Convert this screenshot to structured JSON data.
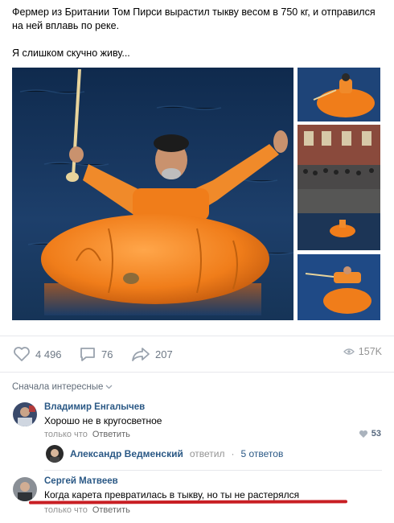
{
  "post": {
    "line1": "Фермер из Британии Том Пирси вырастил тыкву весом в 750 кг, и отправился на ней вплавь по реке.",
    "line2": "Я слишком скучно живу..."
  },
  "actions": {
    "likes": "4 496",
    "comments": "76",
    "shares": "207",
    "views": "157K"
  },
  "sort_label": "Сначала интересные",
  "comments": [
    {
      "author": "Владимир Енгалычев",
      "text": "Хорошо не в кругосветное",
      "time": "только что",
      "reply": "Ответить",
      "likes": "53"
    },
    {
      "author": "Сергей Матвеев",
      "text": "Когда карета превратилась в тыкву, но ты не растерялся",
      "time": "только что",
      "reply": "Ответить"
    }
  ],
  "thread": {
    "author": "Александр Ведменский",
    "replied": "ответил",
    "sep": "·",
    "count": "5 ответов"
  },
  "colors": {
    "link": "#2a5885",
    "water": "#1d3f6b",
    "pumpkin": "#f07d1a",
    "underline": "#c81e23"
  }
}
